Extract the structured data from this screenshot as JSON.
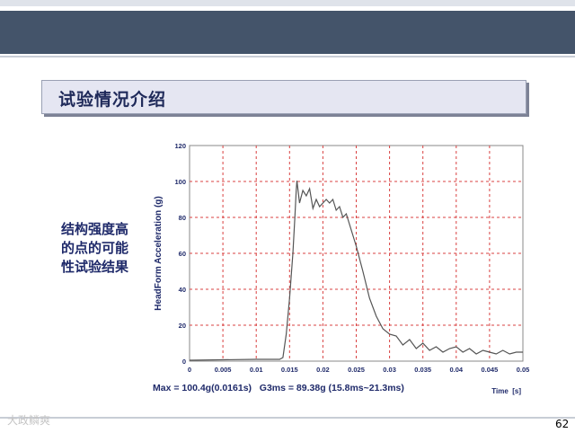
{
  "slide": {
    "title": "试验情况介绍",
    "caption_lines": [
      "结构强度高",
      "的点的可能",
      "性试验结果"
    ],
    "page_number": "62",
    "watermark": "大政鳞爽",
    "colors": {
      "header_band": "#44546a",
      "title_fill": "#e5e6f2",
      "grid": "#d94040",
      "curve": "#555555",
      "text_navy": "#1f2a6a"
    }
  },
  "chart_data": {
    "type": "line",
    "ylabel": "HeadForm Acceleration (g)",
    "xlabel": "Time  [s]",
    "annotation": "Max = 100.4g(0.0161s)   G3ms = 89.38g (15.8ms~21.3ms)",
    "xlim": [
      0,
      0.05
    ],
    "ylim": [
      0,
      120
    ],
    "x_ticks": [
      "0",
      "0.005",
      "0.01",
      "0.015",
      "0.02",
      "0.025",
      "0.03",
      "0.035",
      "0.04",
      "0.045",
      "0.05"
    ],
    "y_ticks": [
      "0",
      "20",
      "40",
      "60",
      "80",
      "100",
      "120"
    ],
    "grid": true,
    "series": [
      {
        "x": [
          0,
          0.01,
          0.0135,
          0.014,
          0.0145,
          0.015,
          0.0155,
          0.0158,
          0.016,
          0.0161,
          0.0165,
          0.017,
          0.0175,
          0.018,
          0.0185,
          0.019,
          0.0195,
          0.02,
          0.0205,
          0.021,
          0.0215,
          0.022,
          0.0225,
          0.023,
          0.0235,
          0.024,
          0.0245,
          0.025,
          0.026,
          0.027,
          0.028,
          0.029,
          0.03,
          0.031,
          0.032,
          0.033,
          0.034,
          0.035,
          0.036,
          0.037,
          0.038,
          0.039,
          0.04,
          0.041,
          0.042,
          0.043,
          0.044,
          0.045,
          0.046,
          0.047,
          0.048,
          0.049,
          0.05
        ],
        "y": [
          0.5,
          1,
          1,
          2,
          15,
          35,
          60,
          80,
          95,
          100.4,
          88,
          95,
          92,
          96,
          85,
          90,
          86,
          88,
          90,
          88,
          90,
          84,
          86,
          80,
          82,
          76,
          70,
          64,
          50,
          35,
          25,
          18,
          15,
          14,
          9,
          12,
          7,
          10,
          6,
          8,
          5,
          7,
          8,
          5,
          7,
          4,
          6,
          5,
          4,
          6,
          4,
          5,
          5
        ]
      }
    ]
  }
}
